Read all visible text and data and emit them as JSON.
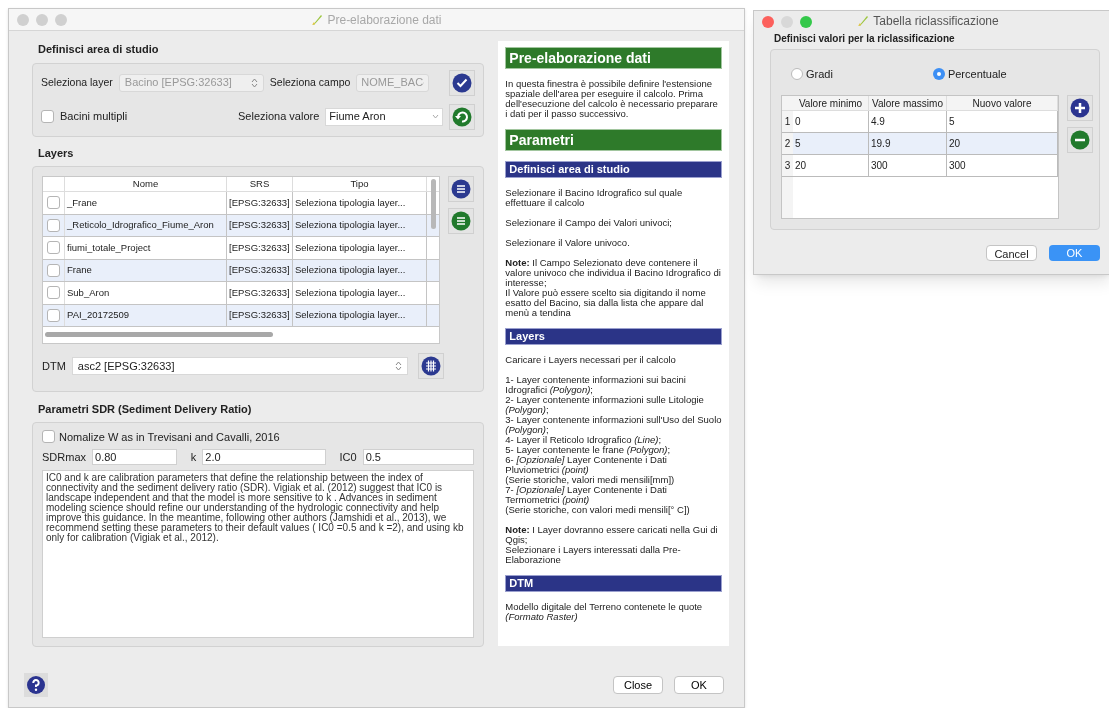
{
  "main_window": {
    "title": "Pre-elaborazione dati",
    "study_area": {
      "title": "Definisci area di studio",
      "layer_label": "Seleziona layer",
      "layer_value": "Bacino [EPSG:32633]",
      "field_label": "Seleziona campo",
      "field_value": "NOME_BAC",
      "multi_label": "Bacini multipli",
      "multi_checked": false,
      "value_label": "Seleziona valore",
      "value_value": "Fiume Aron"
    },
    "layers": {
      "title": "Layers",
      "columns": [
        "Nome",
        "SRS",
        "Tipo"
      ],
      "rows": [
        {
          "checked": false,
          "cells": [
            "_Frane",
            "[EPSG:32633]",
            "Seleziona tipologia layer..."
          ]
        },
        {
          "checked": false,
          "cells": [
            "_Reticolo_Idrografico_Fiume_Aron",
            "[EPSG:32633]",
            "Seleziona tipologia layer..."
          ]
        },
        {
          "checked": false,
          "cells": [
            "fiumi_totale_Project",
            "[EPSG:32633]",
            "Seleziona tipologia layer..."
          ]
        },
        {
          "checked": false,
          "cells": [
            "Frane",
            "[EPSG:32633]",
            "Seleziona tipologia layer..."
          ]
        },
        {
          "checked": false,
          "cells": [
            "Sub_Aron",
            "[EPSG:32633]",
            "Seleziona tipologia layer..."
          ]
        },
        {
          "checked": false,
          "cells": [
            "PAI_20172509",
            "[EPSG:32633]",
            "Seleziona tipologia layer..."
          ]
        }
      ],
      "dtm_label": "DTM",
      "dtm_value": "asc2 [EPSG:32633]"
    },
    "sdr": {
      "title": "Parametri SDR (Sediment Delivery Ratio)",
      "normalize_label": "Nomalize W as in Trevisani and Cavalli, 2016",
      "normalize_checked": false,
      "params": [
        {
          "label": "SDRmax",
          "value": "0.80"
        },
        {
          "label": "k",
          "value": "2.0"
        },
        {
          "label": "IC0",
          "value": "0.5"
        }
      ],
      "description": "IC0 and k are calibration parameters that define the relationship between the index of connectivity and the sediment delivery ratio (SDR). Vigiak et al. (2012) suggest that IC0 is landscape independent and that the model is more sensitive to k . Advances in sediment modeling science should refine our understanding of the hydrologic connectivity and help improve this guidance. In the meantime, following other authors (Jamshidi et al., 2013), we recommend setting these parameters to their default values ( IC0 =0.5 and k =2), and using kb only for calibration (Vigiak et al., 2012)."
    },
    "help": [
      {
        "kind": "title",
        "text": "Pre-elaborazione dati"
      },
      {
        "kind": "paragraph",
        "text": "In questa finestra è possibile definire l'estensione spaziale dell'area per eseguire il calcolo. Prima dell'esecuzione del calcolo è necessario preparare i dati per il passo successivo."
      },
      {
        "kind": "title",
        "text": "Parametri"
      },
      {
        "kind": "heading",
        "text": "Definisci area di studio"
      },
      {
        "kind": "paragraph",
        "text": "Selezionare il Bacino Idrografico sul quale effettuare il calcolo"
      },
      {
        "kind": "paragraph",
        "text": "Selezionare il Campo dei Valori univoci;"
      },
      {
        "kind": "paragraph",
        "text": "Selezionare il Valore univoco."
      },
      {
        "kind": "paragraph",
        "text": "**Note:** Il Campo Selezionato deve contenere il valore univoco che individua il Bacino Idrografico di interesse;\nIl Valore può essere scelto sia digitando il nome esatto del Bacino, sia dalla lista che appare dal menù a tendina"
      },
      {
        "kind": "heading",
        "text": "Layers"
      },
      {
        "kind": "paragraph",
        "text": "Caricare i Layers necessari per il calcolo"
      },
      {
        "kind": "paragraph",
        "text": "1- Layer contenente informazioni sui bacini Idrografici *(Polygon)*;\n2- Layer contenente informazioni sulle Litologie *(Polygon)*;\n3- Layer contenente informazioni sull'Uso del Suolo *(Polygon)*;\n4- Layer il Reticolo Idrografico *(Line)*;\n5- Layer contenente le frane *(Polygon)*;\n6- *[Opzionale]* Layer Contenente i Dati Pluviometrici *(point)*\n    (Serie storiche, valori medi mensili[mm])\n7- *[Opzionale]* Layer Contenente i Dati Termometrici *(point)*\n    (Serie storiche, con valori medi mensili[° C])"
      },
      {
        "kind": "paragraph",
        "text": "**Note:** I Layer dovranno essere caricati nella Gui di Qgis;\nSelezionare i Layers interessati dalla Pre-Elaborazione"
      },
      {
        "kind": "heading",
        "text": "DTM"
      },
      {
        "kind": "paragraph",
        "text": "Modello digitale del Terreno contenete le quote\n*(Formato Raster)*"
      }
    ],
    "buttons": [
      "Close",
      "OK"
    ]
  },
  "reclass_window": {
    "title": "Tabella riclassificazione",
    "section_title": "Definisci valori per la riclassificazione",
    "options": [
      {
        "label": "Gradi",
        "selected": false
      },
      {
        "label": "Percentuale",
        "selected": true
      }
    ],
    "columns": [
      "Valore minimo",
      "Valore massimo",
      "Nuovo valore"
    ],
    "rows": [
      {
        "number": "1",
        "cells": [
          "0",
          "4.9",
          "5"
        ]
      },
      {
        "number": "2",
        "cells": [
          "5",
          "19.9",
          "20"
        ]
      },
      {
        "number": "3",
        "cells": [
          "20",
          "300",
          "300"
        ]
      }
    ],
    "buttons": [
      "Cancel",
      "OK"
    ]
  }
}
